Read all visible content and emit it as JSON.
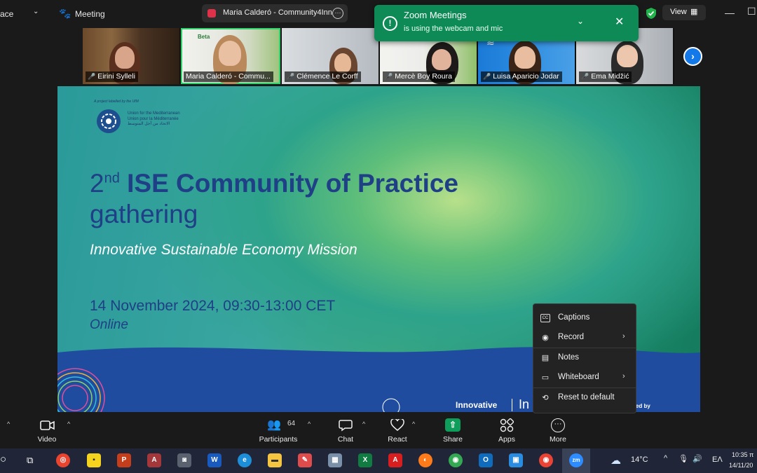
{
  "topbar": {
    "app_fragment": "ace",
    "meeting_label": "Meeting",
    "shared_window_title": "Maria Calderó - Community4Inn",
    "view_label": "View"
  },
  "toast": {
    "title": "Zoom Meetings",
    "subtitle": "is using the webcam and mic"
  },
  "participants_strip": [
    {
      "name": "Eirini Sylleli"
    },
    {
      "name": "Maria Calderó - Commu..."
    },
    {
      "name": "Clémence Le Corff"
    },
    {
      "name": "Mercè Boy Roura"
    },
    {
      "name": "Luisa Aparicio Jodar"
    },
    {
      "name": "Ema Midžić"
    }
  ],
  "slide": {
    "ufm_tag": "A project labelled by the UfM",
    "ufm_line1": "Union for the Mediterranean",
    "ufm_line2": "Union pour la Méditerranée",
    "ufm_line3": "الاتحاد من أجل المتوسط",
    "title_num": "2",
    "title_sup": "nd",
    "title_bold": "ISE Community of Practice",
    "title_line2": "gathering",
    "subtitle": "Innovative Sustainable Economy Mission",
    "date": "14 November 2024, 09:30-13:00 CET",
    "mode": "Online",
    "footer_left": "Innovative",
    "footer_mid": "In",
    "footer_right": "ded by"
  },
  "more_menu": {
    "items": [
      {
        "label": "Captions",
        "icon": "captions-icon",
        "has_submenu": false
      },
      {
        "label": "Record",
        "icon": "record-icon",
        "has_submenu": true
      },
      {
        "label": "Notes",
        "icon": "notes-icon",
        "has_submenu": false
      },
      {
        "label": "Whiteboard",
        "icon": "whiteboard-icon",
        "has_submenu": true
      },
      {
        "label": "Reset to default",
        "icon": "reset-icon",
        "has_submenu": false
      }
    ]
  },
  "toolbar": {
    "video_label": "Video",
    "participants_label": "Participants",
    "participants_count": "64",
    "chat_label": "Chat",
    "react_label": "React",
    "share_label": "Share",
    "apps_label": "Apps",
    "more_label": "More"
  },
  "taskbar": {
    "weather_temp": "14°C",
    "lang": "ΕΛ",
    "time": "10:35 π",
    "date": "14/11/20"
  },
  "colors": {
    "toast_green": "#0d8a55",
    "share_green": "#0e9d5a",
    "slide_title_blue": "#1f3f86",
    "next_button_blue": "#1479e8"
  }
}
